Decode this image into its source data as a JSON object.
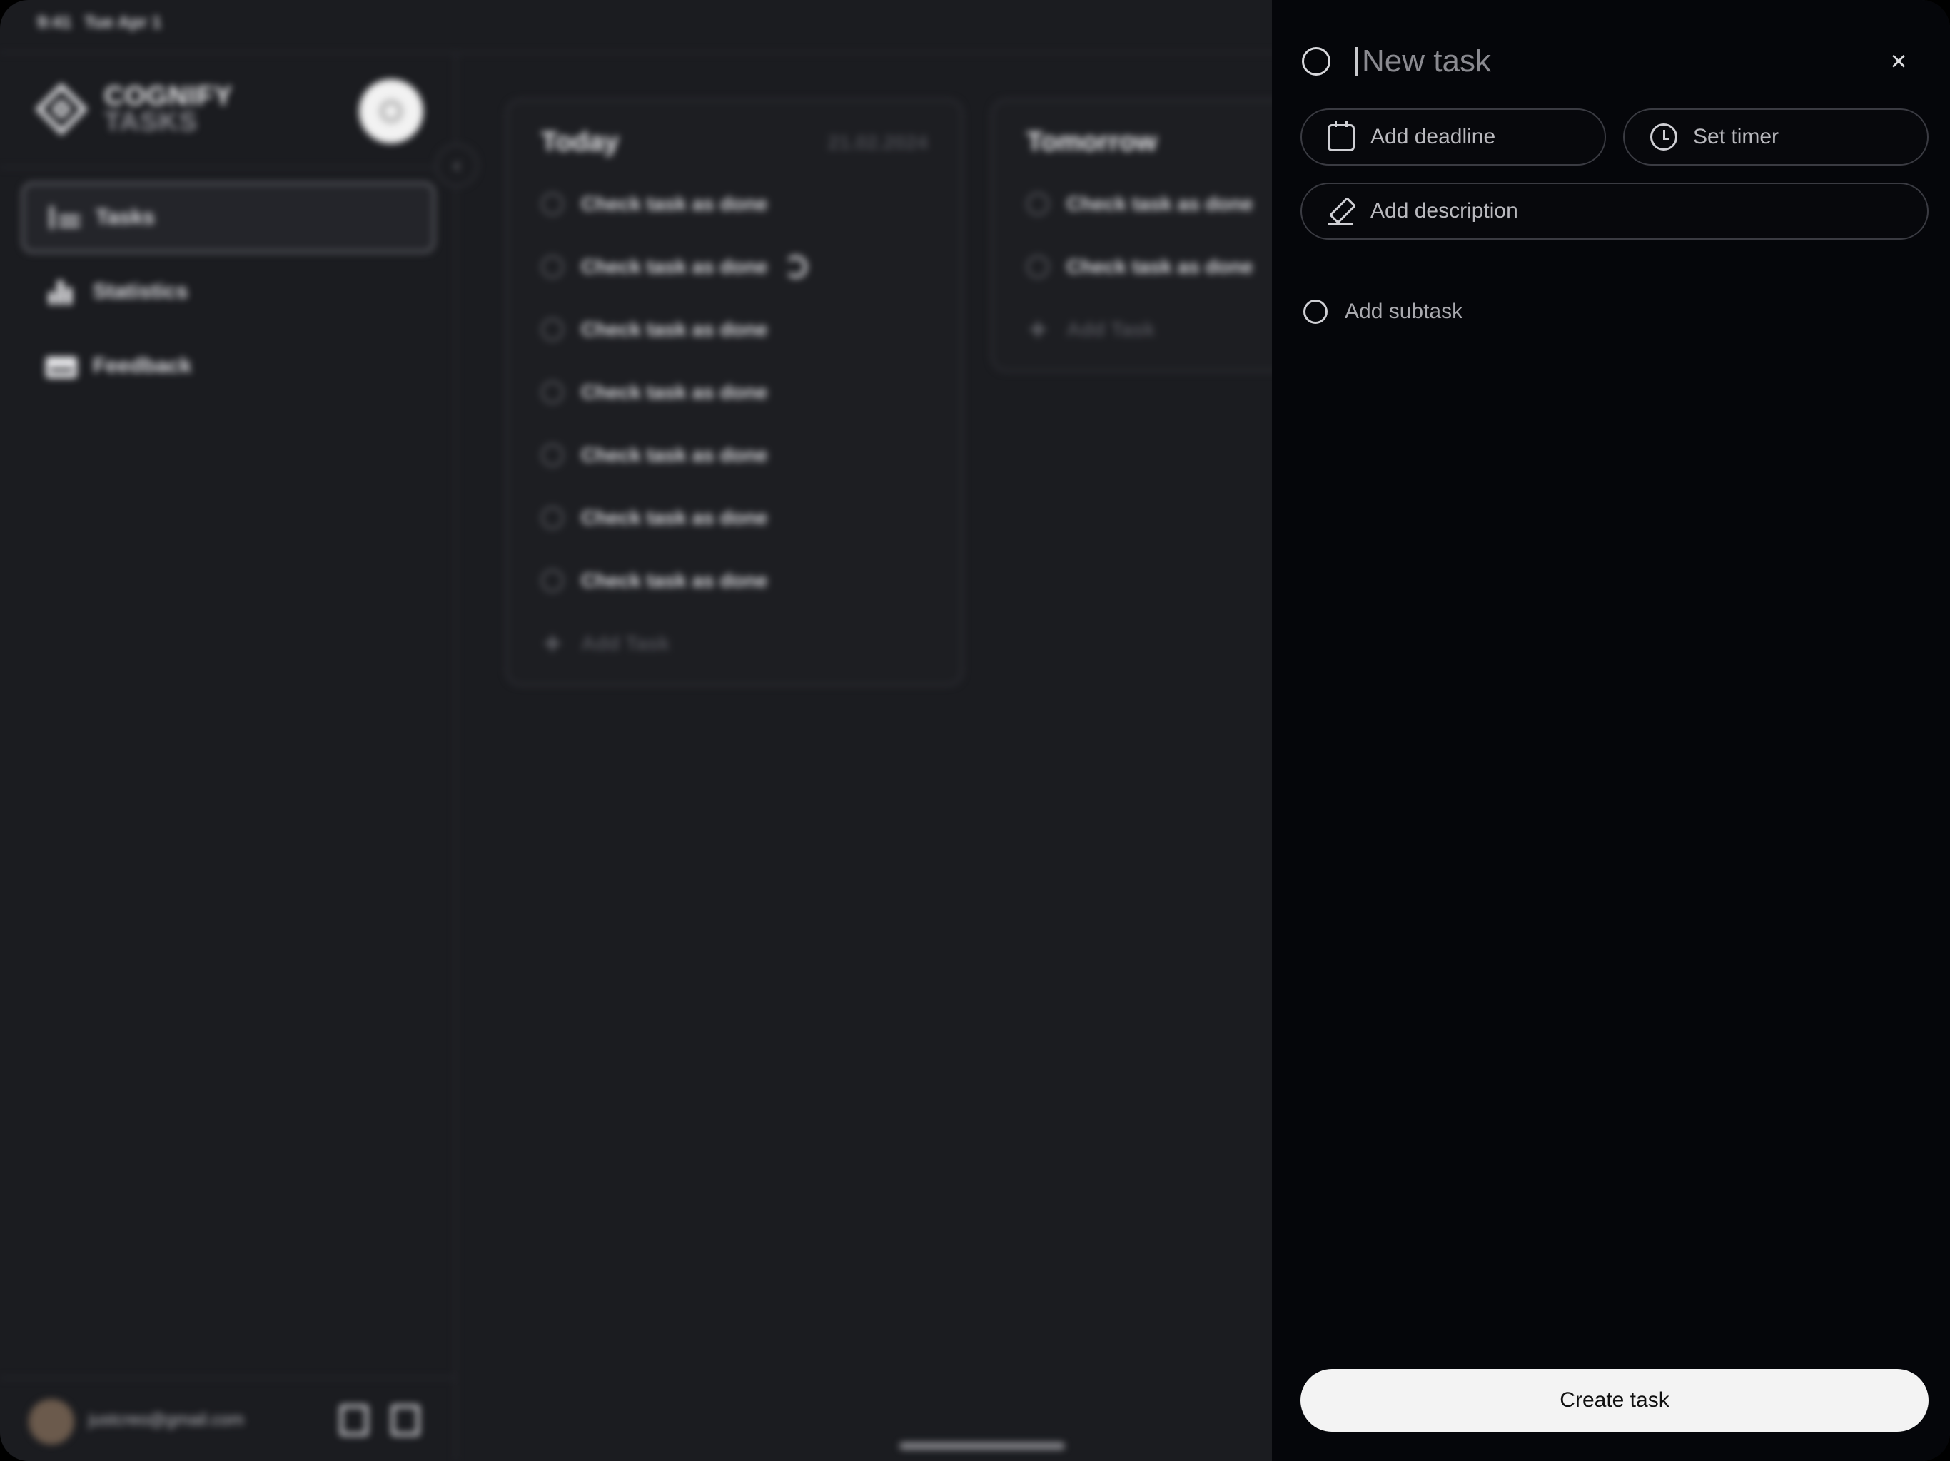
{
  "status_bar": {
    "time": "9:41",
    "date": "Tue Apr 1"
  },
  "brand": {
    "name": "COGNIFY",
    "subtitle": "TASKS"
  },
  "nav": {
    "items": [
      {
        "label": "Tasks",
        "icon": "tasks-list-icon",
        "active": true
      },
      {
        "label": "Statistics",
        "icon": "bar-chart-icon",
        "active": false
      },
      {
        "label": "Feedback",
        "icon": "mail-icon",
        "active": false
      }
    ]
  },
  "user": {
    "email": "justcreo@gmail.com"
  },
  "columns": [
    {
      "title": "Today",
      "date": "21.02.2024",
      "tasks": [
        "Check task as done",
        "Check task as done",
        "Check task as done",
        "Check task as done",
        "Check task as done",
        "Check task as done",
        "Check task as done"
      ],
      "add_label": "Add Task"
    },
    {
      "title": "Tomorrow",
      "date": "",
      "tasks": [
        "Check task as done",
        "Check task as done"
      ],
      "add_label": "Add Task"
    }
  ],
  "panel": {
    "title_placeholder": "New task",
    "deadline_label": "Add deadline",
    "timer_label": "Set timer",
    "description_label": "Add description",
    "subtask_label": "Add subtask",
    "create_label": "Create task"
  },
  "colors": {
    "app_background": "#1b1c20",
    "panel_background": "#05060a",
    "primary_button": "#f3f3f3"
  }
}
